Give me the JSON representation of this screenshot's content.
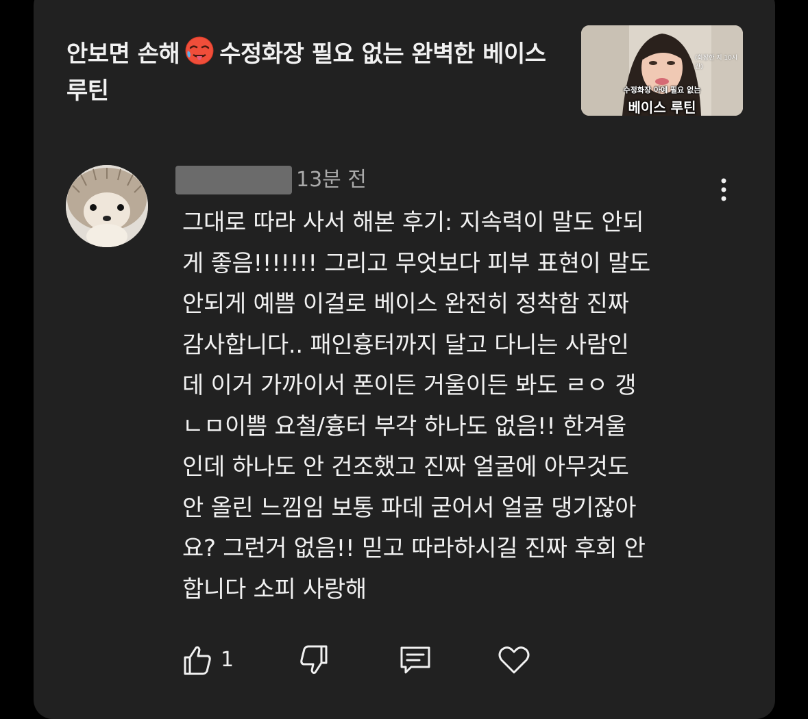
{
  "video": {
    "title_part1": "안보면 손해",
    "title_emoji": "hot-face-emoji",
    "title_part2": "수정화장 필요 없는 완벽한 베이스 루틴",
    "thumbnail": {
      "small_caption": "수정화장 아예 필요 없는",
      "big_caption": "베이스 루틴",
      "side_caption": "(화장한 지 10시간)"
    }
  },
  "comment": {
    "author_hidden": true,
    "timestamp": "13분 전",
    "text": "그대로 따라 사서 해본 후기: 지속력이 말도 안되\n게 좋음!!!!!!! 그리고 무엇보다 피부 표현이 말도\n안되게 예쁨 이걸로 베이스 완전히 정착함 진짜\n감사합니다.. 패인흉터까지 달고 다니는 사람인\n데 이거 가까이서 폰이든 거울이든 봐도 ㄹㅇ 갱\nㄴㅁ이쁨 요철/흉터 부각 하나도 없음!! 한겨울\n인데 하나도 안 건조했고 진짜 얼굴에 아무것도\n안 올린 느낌임 보통 파데 굳어서 얼굴 댕기잖아\n요? 그런거 없음!! 믿고 따라하시길 진짜 후회 안\n합니다 소피 사랑해",
    "like_count": "1"
  },
  "icons": {
    "avatar": "hedgehog-avatar",
    "more": "more-vert-icon",
    "like": "thumbs-up-icon",
    "dislike": "thumbs-down-icon",
    "reply": "reply-comment-icon",
    "heart": "heart-icon"
  },
  "colors": {
    "background": "#000000",
    "card": "#212121",
    "text_primary": "#f1f1f1",
    "text_secondary": "#aaaaaa"
  }
}
